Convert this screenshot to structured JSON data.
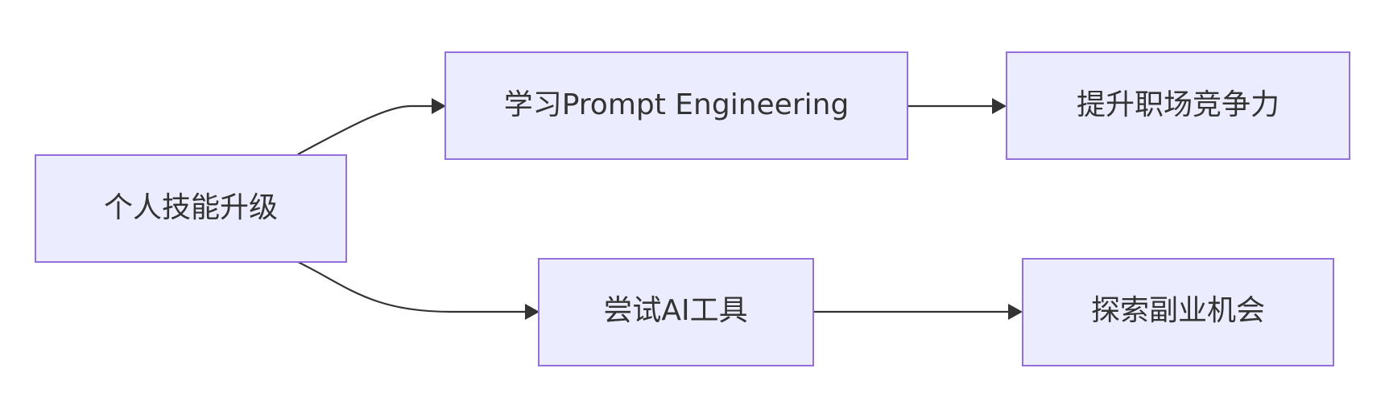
{
  "diagram": {
    "type": "flowchart",
    "direction": "left-to-right",
    "colors": {
      "node_fill": "#ECECFF",
      "node_border": "#9370DB",
      "edge": "#333333",
      "text": "#333333",
      "background": "#FFFFFF"
    },
    "nodes": {
      "root": {
        "label": "个人技能升级"
      },
      "prompt": {
        "label": "学习Prompt Engineering"
      },
      "ai_tools": {
        "label": "尝试AI工具"
      },
      "career": {
        "label": "提升职场竞争力"
      },
      "side_job": {
        "label": "探索副业机会"
      }
    },
    "edges": [
      {
        "from": "root",
        "to": "prompt"
      },
      {
        "from": "root",
        "to": "ai_tools"
      },
      {
        "from": "prompt",
        "to": "career"
      },
      {
        "from": "ai_tools",
        "to": "side_job"
      }
    ]
  }
}
